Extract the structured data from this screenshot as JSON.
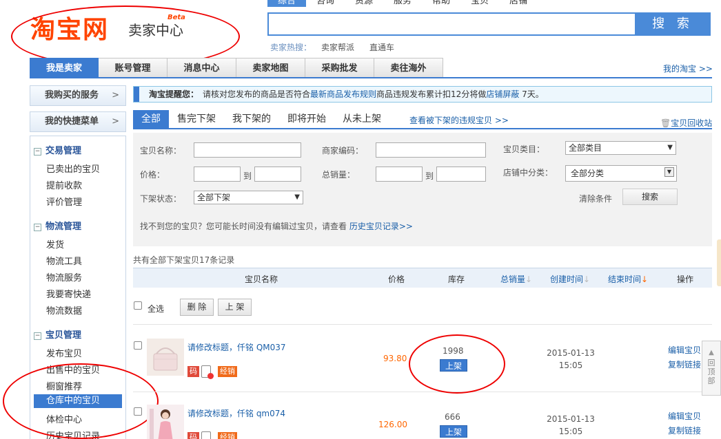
{
  "header": {
    "logo_main": "淘宝网",
    "logo_sub": "卖家中心",
    "logo_beta": "Beta",
    "search_tabs": [
      "综合",
      "咨询",
      "资源",
      "服务",
      "帮助",
      "宝贝",
      "店铺"
    ],
    "search_button": "搜 索",
    "hot_label": "卖家热搜：",
    "hot_items": [
      "卖家帮派",
      "直通车"
    ]
  },
  "nav": {
    "items": [
      "我是卖家",
      "账号管理",
      "消息中心",
      "卖家地图",
      "采购批发",
      "卖往海外"
    ],
    "right_link": "我的淘宝 >>"
  },
  "sidebar": {
    "buttons": [
      {
        "label": "我购买的服务",
        "arrow": ">"
      },
      {
        "label": "我的快捷菜单",
        "arrow": ">"
      }
    ],
    "sections": [
      {
        "title": "交易管理",
        "toggle": "−",
        "items": [
          "已卖出的宝贝",
          "提前收款",
          "评价管理"
        ]
      },
      {
        "title": "物流管理",
        "toggle": "−",
        "items": [
          "发货",
          "物流工具",
          "物流服务",
          "我要寄快递",
          "物流数据"
        ]
      },
      {
        "title": "宝贝管理",
        "toggle": "−",
        "items": [
          "发布宝贝",
          "出售中的宝贝",
          "橱窗推荐",
          "仓库中的宝贝",
          "体检中心",
          "历史宝贝记录"
        ]
      }
    ],
    "active_item": "仓库中的宝贝"
  },
  "notice": {
    "prefix": "淘宝提醒您：",
    "text1": "请核对您发布的商品是否符合",
    "link1": "最新商品发布规则",
    "text2": "商品违规发布累计扣12分将做",
    "link2": "店铺屏蔽",
    "text3": " 7天。"
  },
  "tabs": {
    "items": [
      "全部",
      "售完下架",
      "我下架的",
      "即将开始",
      "从未上架"
    ],
    "violation_link": "查看被下架的违规宝贝 >>",
    "recycle_link": "宝贝回收站"
  },
  "filter": {
    "name_label": "宝贝名称：",
    "code_label": "商家编码：",
    "category_label": "宝贝类目：",
    "category_value": "全部类目",
    "price_label": "价格：",
    "to": "到",
    "sales_label": "总销量：",
    "shop_cat_label": "店铺中分类：",
    "shop_cat_value": "全部分类",
    "status_label": "下架状态：",
    "status_value": "全部下架",
    "clear": "清除条件",
    "search": "搜索",
    "hint": "找不到您的宝贝？您可能长时间没有编辑过宝贝，请查看",
    "hint_link": "历史宝贝记录>>"
  },
  "record_text": "共有全部下架宝贝17条记录",
  "table": {
    "headers": {
      "name": "宝贝名称",
      "price": "价格",
      "stock": "库存",
      "sales": "总销量",
      "created": "创建时间",
      "ended": "结束时间",
      "ops": "操作"
    },
    "select_all": "全选",
    "delete": "删 除",
    "list": "上 架",
    "rows": [
      {
        "title": "请修改标题，仟铭 QM037",
        "price": "93.80",
        "stock": "1998",
        "action": "上架",
        "date": "2015-01-13",
        "time": "15:05",
        "op1": "编辑宝贝",
        "op2": "复制链接",
        "tag1": "码",
        "tag3": "经销"
      },
      {
        "title": "请修改标题，仟铭 qm074",
        "price": "126.00",
        "stock": "666",
        "action": "上架",
        "date": "2015-01-13",
        "time": "15:05",
        "op1": "编辑宝贝",
        "op2": "复制链接",
        "tag1": "码",
        "tag3": "经销"
      }
    ]
  },
  "back_to_top": "回顶部"
}
